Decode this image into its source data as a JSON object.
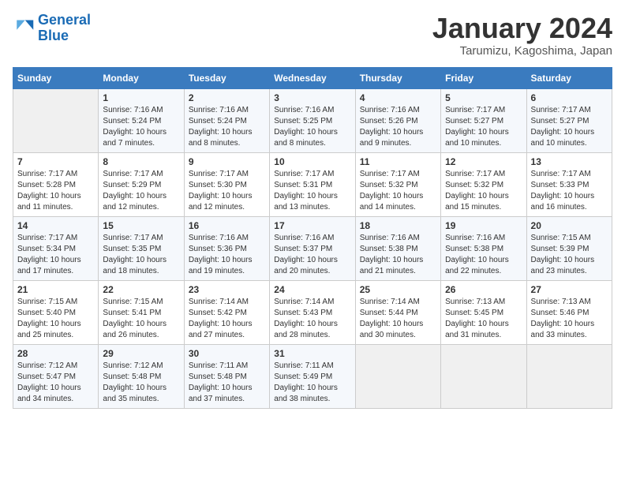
{
  "logo": {
    "line1": "General",
    "line2": "Blue"
  },
  "title": "January 2024",
  "subtitle": "Tarumizu, Kagoshima, Japan",
  "days_of_week": [
    "Sunday",
    "Monday",
    "Tuesday",
    "Wednesday",
    "Thursday",
    "Friday",
    "Saturday"
  ],
  "weeks": [
    [
      {
        "day": "",
        "info": ""
      },
      {
        "day": "1",
        "info": "Sunrise: 7:16 AM\nSunset: 5:24 PM\nDaylight: 10 hours\nand 7 minutes."
      },
      {
        "day": "2",
        "info": "Sunrise: 7:16 AM\nSunset: 5:24 PM\nDaylight: 10 hours\nand 8 minutes."
      },
      {
        "day": "3",
        "info": "Sunrise: 7:16 AM\nSunset: 5:25 PM\nDaylight: 10 hours\nand 8 minutes."
      },
      {
        "day": "4",
        "info": "Sunrise: 7:16 AM\nSunset: 5:26 PM\nDaylight: 10 hours\nand 9 minutes."
      },
      {
        "day": "5",
        "info": "Sunrise: 7:17 AM\nSunset: 5:27 PM\nDaylight: 10 hours\nand 10 minutes."
      },
      {
        "day": "6",
        "info": "Sunrise: 7:17 AM\nSunset: 5:27 PM\nDaylight: 10 hours\nand 10 minutes."
      }
    ],
    [
      {
        "day": "7",
        "info": "Sunrise: 7:17 AM\nSunset: 5:28 PM\nDaylight: 10 hours\nand 11 minutes."
      },
      {
        "day": "8",
        "info": "Sunrise: 7:17 AM\nSunset: 5:29 PM\nDaylight: 10 hours\nand 12 minutes."
      },
      {
        "day": "9",
        "info": "Sunrise: 7:17 AM\nSunset: 5:30 PM\nDaylight: 10 hours\nand 12 minutes."
      },
      {
        "day": "10",
        "info": "Sunrise: 7:17 AM\nSunset: 5:31 PM\nDaylight: 10 hours\nand 13 minutes."
      },
      {
        "day": "11",
        "info": "Sunrise: 7:17 AM\nSunset: 5:32 PM\nDaylight: 10 hours\nand 14 minutes."
      },
      {
        "day": "12",
        "info": "Sunrise: 7:17 AM\nSunset: 5:32 PM\nDaylight: 10 hours\nand 15 minutes."
      },
      {
        "day": "13",
        "info": "Sunrise: 7:17 AM\nSunset: 5:33 PM\nDaylight: 10 hours\nand 16 minutes."
      }
    ],
    [
      {
        "day": "14",
        "info": "Sunrise: 7:17 AM\nSunset: 5:34 PM\nDaylight: 10 hours\nand 17 minutes."
      },
      {
        "day": "15",
        "info": "Sunrise: 7:17 AM\nSunset: 5:35 PM\nDaylight: 10 hours\nand 18 minutes."
      },
      {
        "day": "16",
        "info": "Sunrise: 7:16 AM\nSunset: 5:36 PM\nDaylight: 10 hours\nand 19 minutes."
      },
      {
        "day": "17",
        "info": "Sunrise: 7:16 AM\nSunset: 5:37 PM\nDaylight: 10 hours\nand 20 minutes."
      },
      {
        "day": "18",
        "info": "Sunrise: 7:16 AM\nSunset: 5:38 PM\nDaylight: 10 hours\nand 21 minutes."
      },
      {
        "day": "19",
        "info": "Sunrise: 7:16 AM\nSunset: 5:38 PM\nDaylight: 10 hours\nand 22 minutes."
      },
      {
        "day": "20",
        "info": "Sunrise: 7:15 AM\nSunset: 5:39 PM\nDaylight: 10 hours\nand 23 minutes."
      }
    ],
    [
      {
        "day": "21",
        "info": "Sunrise: 7:15 AM\nSunset: 5:40 PM\nDaylight: 10 hours\nand 25 minutes."
      },
      {
        "day": "22",
        "info": "Sunrise: 7:15 AM\nSunset: 5:41 PM\nDaylight: 10 hours\nand 26 minutes."
      },
      {
        "day": "23",
        "info": "Sunrise: 7:14 AM\nSunset: 5:42 PM\nDaylight: 10 hours\nand 27 minutes."
      },
      {
        "day": "24",
        "info": "Sunrise: 7:14 AM\nSunset: 5:43 PM\nDaylight: 10 hours\nand 28 minutes."
      },
      {
        "day": "25",
        "info": "Sunrise: 7:14 AM\nSunset: 5:44 PM\nDaylight: 10 hours\nand 30 minutes."
      },
      {
        "day": "26",
        "info": "Sunrise: 7:13 AM\nSunset: 5:45 PM\nDaylight: 10 hours\nand 31 minutes."
      },
      {
        "day": "27",
        "info": "Sunrise: 7:13 AM\nSunset: 5:46 PM\nDaylight: 10 hours\nand 33 minutes."
      }
    ],
    [
      {
        "day": "28",
        "info": "Sunrise: 7:12 AM\nSunset: 5:47 PM\nDaylight: 10 hours\nand 34 minutes."
      },
      {
        "day": "29",
        "info": "Sunrise: 7:12 AM\nSunset: 5:48 PM\nDaylight: 10 hours\nand 35 minutes."
      },
      {
        "day": "30",
        "info": "Sunrise: 7:11 AM\nSunset: 5:48 PM\nDaylight: 10 hours\nand 37 minutes."
      },
      {
        "day": "31",
        "info": "Sunrise: 7:11 AM\nSunset: 5:49 PM\nDaylight: 10 hours\nand 38 minutes."
      },
      {
        "day": "",
        "info": ""
      },
      {
        "day": "",
        "info": ""
      },
      {
        "day": "",
        "info": ""
      }
    ]
  ]
}
